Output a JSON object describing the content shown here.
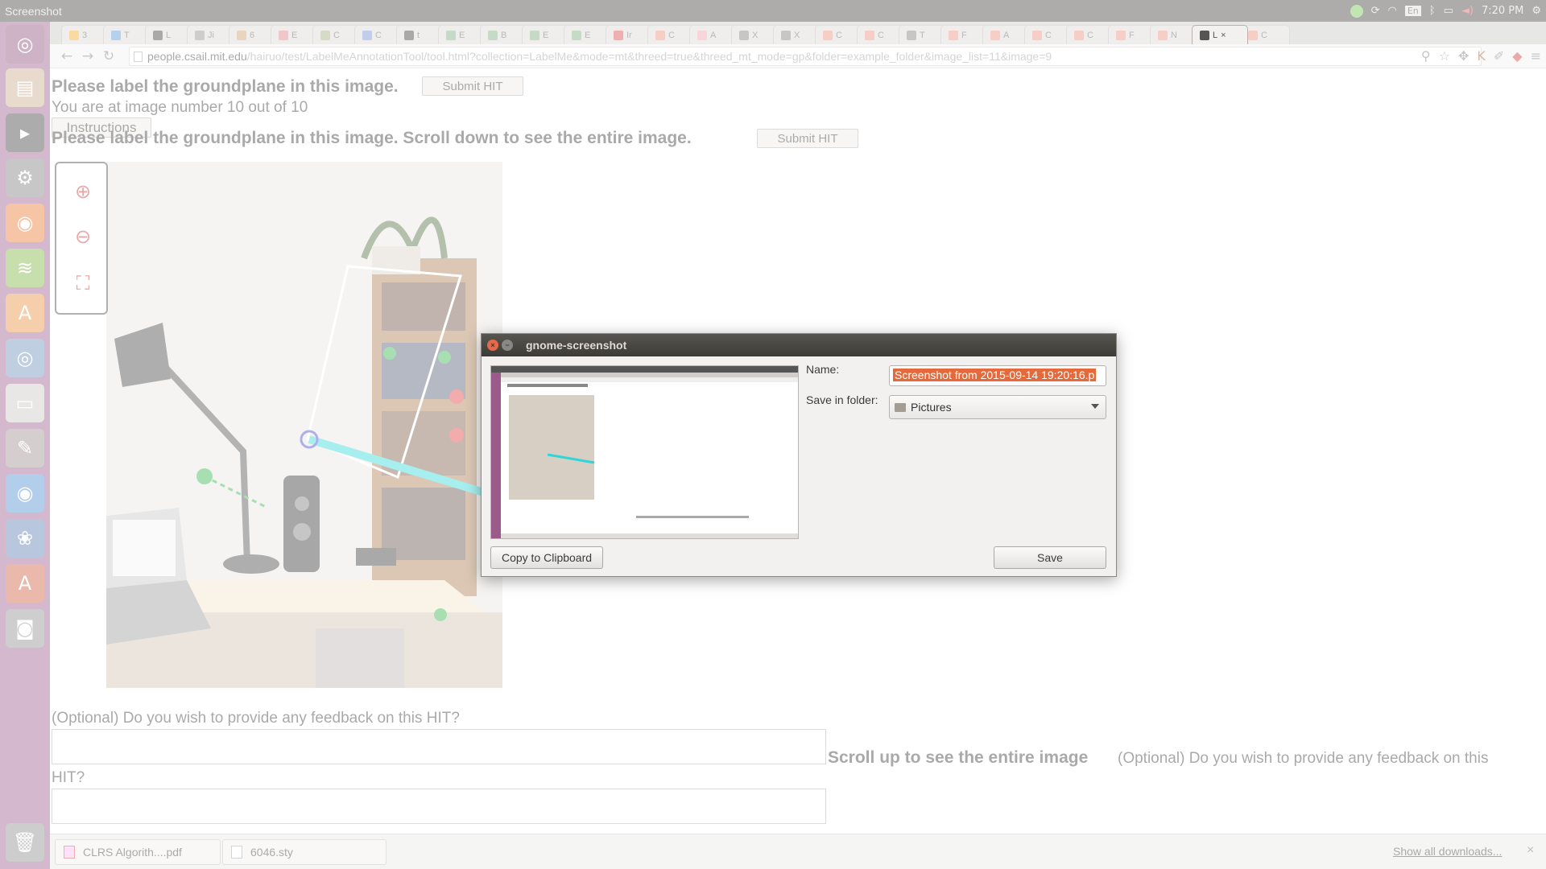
{
  "top_panel": {
    "app_title": "Screenshot",
    "clock": "7:20 PM",
    "keyboard": "En"
  },
  "browser": {
    "tabs": [
      {
        "label": "3"
      },
      {
        "label": "T"
      },
      {
        "label": "L"
      },
      {
        "label": "Ji"
      },
      {
        "label": "6"
      },
      {
        "label": "E"
      },
      {
        "label": "C"
      },
      {
        "label": "C"
      },
      {
        "label": "t"
      },
      {
        "label": "E"
      },
      {
        "label": "B"
      },
      {
        "label": "E"
      },
      {
        "label": "E"
      },
      {
        "label": "Ir"
      },
      {
        "label": "C"
      },
      {
        "label": "A"
      },
      {
        "label": "X"
      },
      {
        "label": "X"
      },
      {
        "label": "C"
      },
      {
        "label": "C"
      },
      {
        "label": "T"
      },
      {
        "label": "F"
      },
      {
        "label": "A"
      },
      {
        "label": "C"
      },
      {
        "label": "C"
      },
      {
        "label": "F"
      },
      {
        "label": "N"
      },
      {
        "label": "L",
        "active": true
      },
      {
        "label": "C"
      }
    ],
    "url_host": "people.csail.mit.edu",
    "url_path": "/hairuo/test/LabelMeAnnotationTool/tool.html?collection=LabelMe&mode=mt&threed=true&threed_mt_mode=gp&folder=example_folder&image_list=11&image=9"
  },
  "page": {
    "heading": "Please label the groundplane in this image.",
    "submit_label": "Submit HIT",
    "image_counter": "You are at image number 10 out of 10",
    "instructions_label": "Instructions",
    "heading_scroll": "Please label the groundplane in this image. Scroll down to see the entire image.",
    "submit_label_2": "Submit HIT",
    "feedback_question": "(Optional) Do you wish to provide any feedback on this HIT?",
    "scroll_up": "Scroll up to see the entire image",
    "feedback_question_2_line1": "(Optional) Do you wish to provide any feedback on this",
    "feedback_question_2_line2": "HIT?"
  },
  "downloads": {
    "items": [
      {
        "name": "CLRS Algorith....pdf"
      },
      {
        "name": "6046.sty"
      }
    ],
    "show_all": "Show all downloads..."
  },
  "dialog": {
    "title": "gnome-screenshot",
    "name_label": "Name:",
    "name_value": "Screenshot from 2015-09-14 19:20:16.p",
    "folder_label": "Save in folder:",
    "folder_value": "Pictures",
    "copy_button": "Copy to Clipboard",
    "save_button": "Save"
  },
  "colors": {
    "launcher": "#9a5a8a",
    "panel": "#3c3b37",
    "selection": "#e46a3c",
    "annotation_line": "#2fd6d8"
  }
}
